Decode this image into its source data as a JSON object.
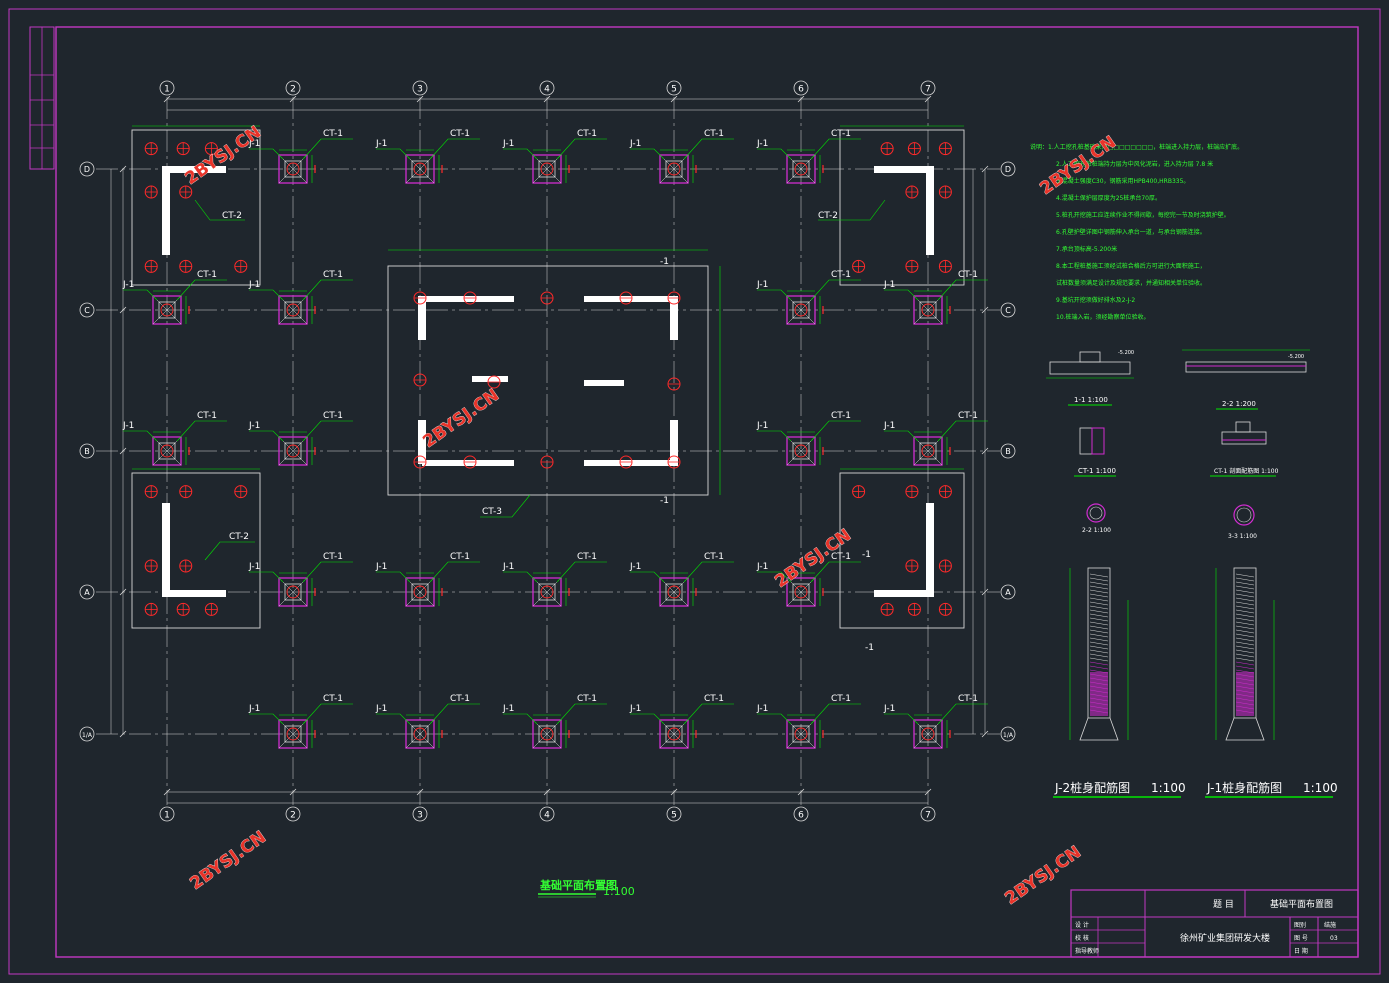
{
  "colors": {
    "background": "#1f262d",
    "frame": "#c238c2",
    "line": "#d9d9d9",
    "dim": "#00e600",
    "pile": "#ff2a2a",
    "cap": "#d02cd0",
    "wall": "#ffffff",
    "label": "#ffffff",
    "watermark": "#e8342a",
    "notes": "#33ff33"
  },
  "grid": {
    "columns": [
      "1",
      "2",
      "3",
      "4",
      "5",
      "6",
      "7"
    ],
    "rows": [
      "D",
      "C",
      "B",
      "A",
      "1/A"
    ]
  },
  "labels": {
    "j1": "J-1",
    "ct1": "CT-1",
    "ct2": "CT-2",
    "ct3": "CT-3",
    "minus1": "-1"
  },
  "watermark": "2BYSJ.CN",
  "plan_title": "基础平面布置图",
  "plan_scale": "1:100",
  "notes": [
    "说明：1.人工挖孔桩基础采用□□□□□□□□，桩端进入持力层，桩端应扩底。",
    "2.人工挖孔桩桩端持力层为中风化泥岩，进入持力层 7.8 米",
    "3.混凝土强度C30，钢筋采用HPB400,HRB335。",
    "4.混凝土保护层厚度为25桩承台70厚。",
    "5.桩孔开挖施工应连续作业不得间歇，每挖完一节及时浇筑护壁。",
    "6.孔壁护壁详图中钢筋伸入承台一道，与承台钢筋连接。",
    "7.承台顶标高-5.200米",
    "8.本工程桩基施工须经试桩合格后方可进行大面积施工，",
    "试桩数量须满足设计及规范要求，并通知相关单位验收。",
    "9.基坑开挖须做好排水及2-J-2",
    "10.桩端入岩，须经勘察单位验收。"
  ],
  "details": {
    "sec11": "1-1 1:100",
    "sec22plan": "2-2 1:200",
    "ct1": "CT-1 1:100",
    "ct1b": "CT-1 剖面配筋图 1:100",
    "s22": "2-2 1:100",
    "s33": "3-3 1:100",
    "j2": "J-2桩身配筋图",
    "j1": "J-1桩身配筋图",
    "scale": "1:100",
    "elev": "-5.200"
  },
  "title_block": {
    "label_title": "题  目",
    "drawing_name": "基础平面布置图",
    "project": "徐州矿业集团研发大楼",
    "rows_left": [
      "设 计",
      "校 核",
      "指导教师"
    ],
    "right_top_label": "图别",
    "right_top_value": "结施",
    "right_mid_label": "图 号",
    "right_mid_value": "03",
    "right_bot_label": "日 期"
  }
}
